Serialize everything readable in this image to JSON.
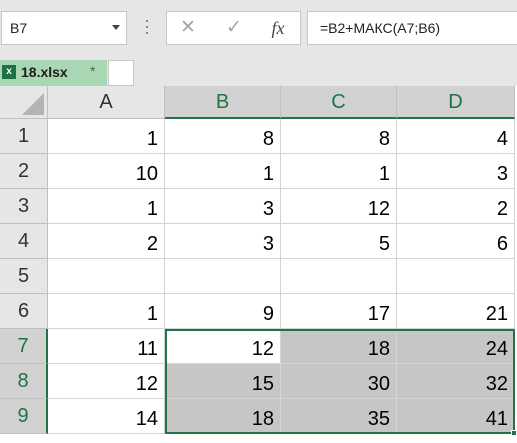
{
  "formula_bar": {
    "name_box": "B7",
    "cancel_icon": "✕",
    "enter_icon": "✓",
    "fx_label": "fx",
    "formula": "=B2+МАКС(A7;B6)"
  },
  "tabs": [
    {
      "label": "18.xlsx",
      "modified": "*",
      "file_icon": "x"
    }
  ],
  "columns": [
    "A",
    "B",
    "C",
    "D"
  ],
  "rows": [
    {
      "num": "1",
      "cells": [
        "1",
        "8",
        "8",
        "4"
      ]
    },
    {
      "num": "2",
      "cells": [
        "10",
        "1",
        "1",
        "3"
      ]
    },
    {
      "num": "3",
      "cells": [
        "1",
        "3",
        "12",
        "2"
      ]
    },
    {
      "num": "4",
      "cells": [
        "2",
        "3",
        "5",
        "6"
      ]
    },
    {
      "num": "5",
      "cells": [
        "",
        "",
        "",
        ""
      ]
    },
    {
      "num": "6",
      "cells": [
        "1",
        "9",
        "17",
        "21"
      ]
    },
    {
      "num": "7",
      "cells": [
        "11",
        "12",
        "18",
        "24"
      ]
    },
    {
      "num": "8",
      "cells": [
        "12",
        "15",
        "30",
        "32"
      ]
    },
    {
      "num": "9",
      "cells": [
        "14",
        "18",
        "35",
        "41"
      ]
    }
  ],
  "selection": {
    "range": "B7:D9",
    "active_cell": "B7"
  },
  "colors": {
    "accent": "#217346",
    "selection_fill": "#c6c6c6",
    "tab_bg": "#a9d7b4"
  }
}
